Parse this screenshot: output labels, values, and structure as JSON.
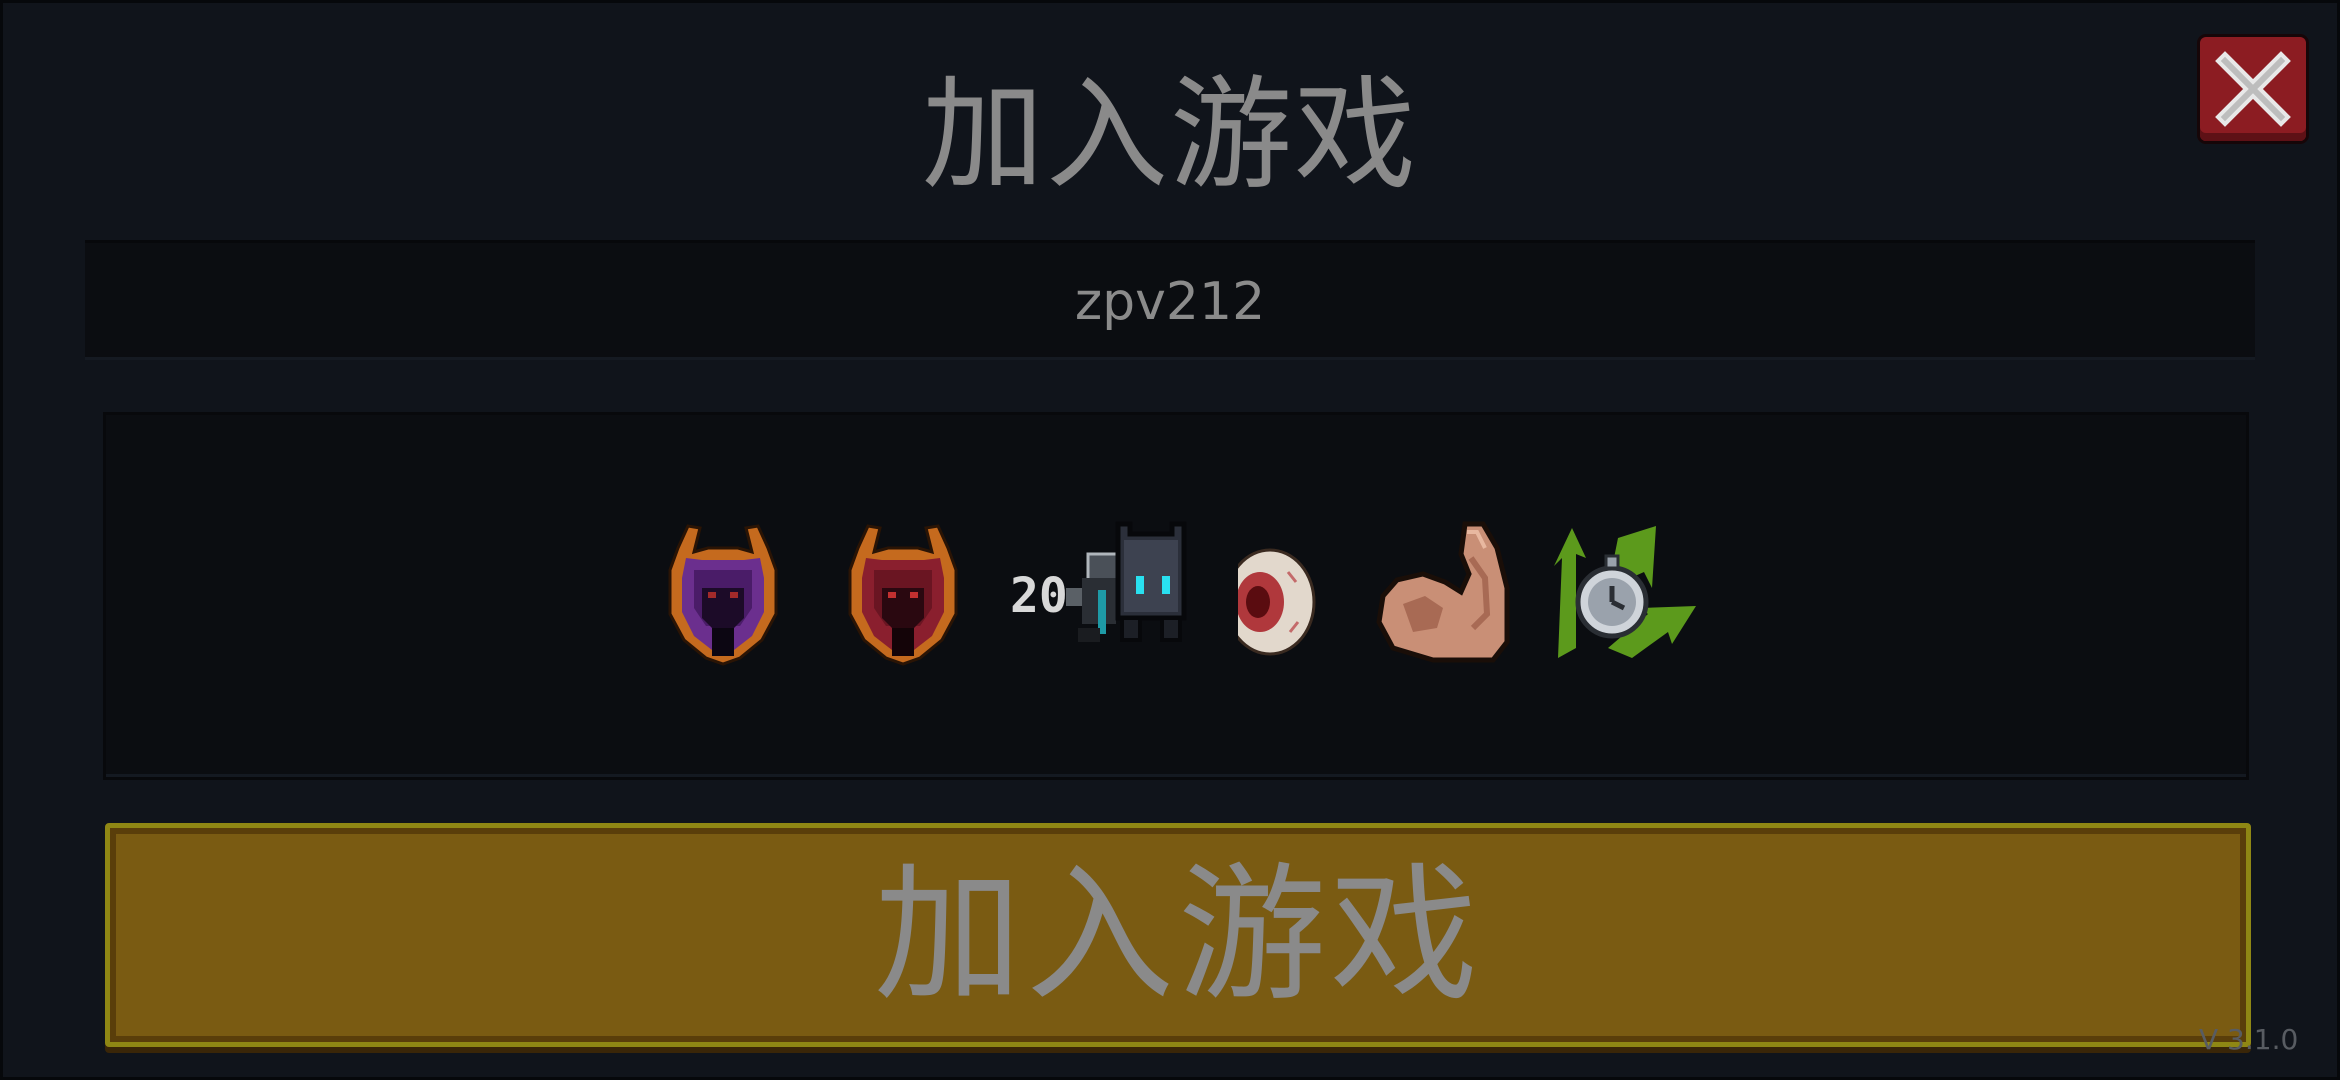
{
  "dialog": {
    "title": "加入游戏",
    "room_code": "zpv212",
    "join_button_label": "加入游戏",
    "version": "V 3.1.0"
  },
  "items": [
    {
      "name": "purple-helmet-icon"
    },
    {
      "name": "red-helmet-icon"
    },
    {
      "name": "pet-cat-icon",
      "label": "20"
    },
    {
      "name": "eyeball-icon"
    },
    {
      "name": "muscle-arm-icon"
    },
    {
      "name": "stopwatch-icon"
    }
  ],
  "colors": {
    "panel": "#10141b",
    "close": "#8c1c22",
    "join": "#7a5b12",
    "text": "#8a8a8a"
  }
}
